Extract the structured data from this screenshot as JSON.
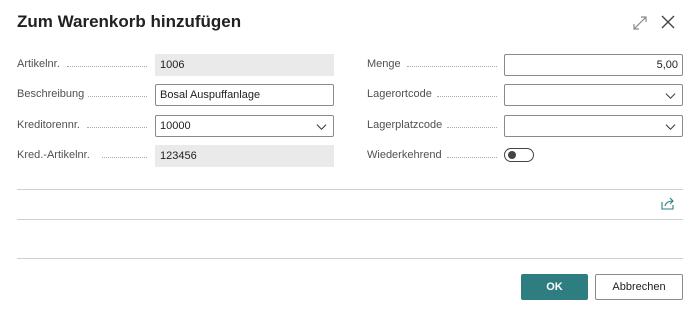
{
  "dialog": {
    "title": "Zum Warenkorb hinzufügen"
  },
  "left_fields": [
    {
      "label": "Artikelnr.",
      "value": "1006"
    },
    {
      "label": "Beschreibung",
      "value": "Bosal Auspuffanlage"
    },
    {
      "label": "Kreditorennr.",
      "value": "10000"
    },
    {
      "label": "Kred.-Artikelnr.",
      "value": "123456"
    }
  ],
  "right_fields": [
    {
      "label": "Menge",
      "value": "5,00"
    },
    {
      "label": "Lagerortcode",
      "value": ""
    },
    {
      "label": "Lagerplatzcode",
      "value": ""
    },
    {
      "label": "Wiederkehrend",
      "value": false
    }
  ],
  "buttons": {
    "ok": "OK",
    "cancel": "Abbrechen"
  },
  "colors": {
    "accent": "#2e7d81"
  },
  "icons": [
    "expand-icon",
    "close-icon",
    "share-icon",
    "chevron-down-icon"
  ]
}
